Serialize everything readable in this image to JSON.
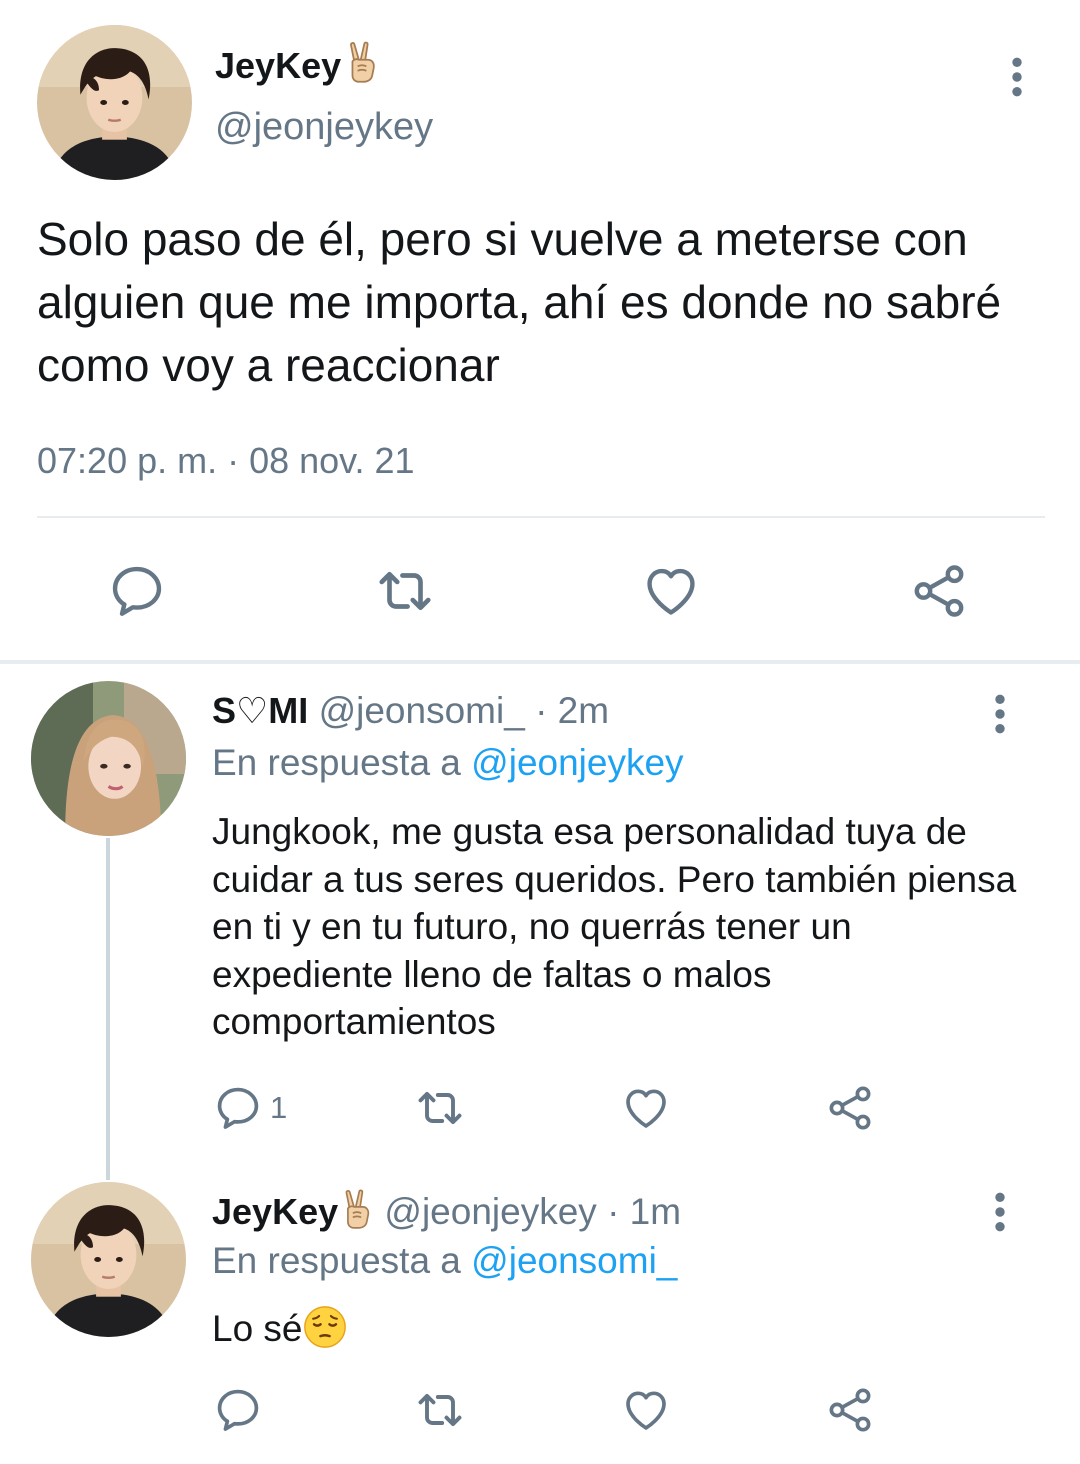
{
  "main_tweet": {
    "author_name": "JeyKey",
    "author_emoji": "victory-hand-emoji",
    "author_handle": "@jeonjeykey",
    "text": "Solo paso de él, pero si vuelve a meterse con alguien que me importa, ahí es donde no sabré como voy a reaccionar",
    "timestamp": "07:20 p. m. · 08 nov. 21"
  },
  "replies": [
    {
      "author_name": "S♡MI",
      "author_handle": "@jeonsomi_",
      "time_ago": "· 2m",
      "reply_prefix": "En respuesta a",
      "reply_to": "@jeonjeykey",
      "text": "Jungkook, me gusta esa personalidad tuya de cuidar a tus seres queridos. Pero también piensa en ti y en tu futuro, no querrás tener un expediente lleno de faltas o malos comportamientos",
      "reply_count": "1"
    },
    {
      "author_name": "JeyKey",
      "author_emoji": "victory-hand-emoji",
      "author_handle": "@jeonjeykey",
      "time_ago": "· 1m",
      "reply_prefix": "En respuesta a",
      "reply_to": "@jeonsomi_",
      "text": "Lo sé",
      "text_emoji": "pensive-face-emoji"
    }
  ],
  "colors": {
    "text": "#14171a",
    "secondary": "#657786",
    "link": "#1da1f2",
    "divider": "#e6ecf0",
    "icon": "#657786"
  }
}
